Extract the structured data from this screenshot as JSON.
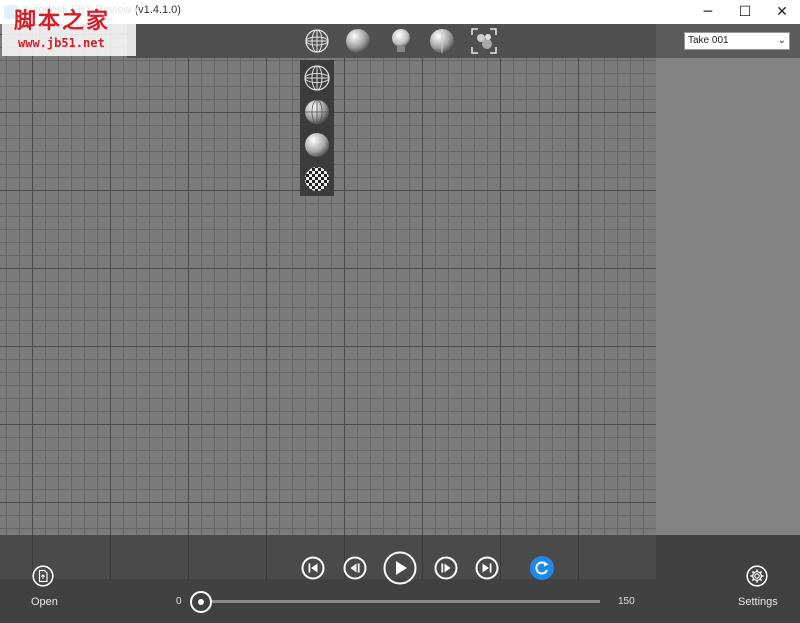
{
  "window": {
    "title": "Autodesk FBX Review (v1.4.1.0)",
    "min_glyph": "─",
    "max_glyph": "☐",
    "close_glyph": "✕"
  },
  "watermark": {
    "text": "脚本之家",
    "url": "www.jb51.net"
  },
  "take": {
    "selected": "Take 001",
    "chevron": "⌄"
  },
  "toolbar": {
    "icons": [
      "wireframe-sphere-icon",
      "shaded-sphere-icon",
      "light-bulb-icon",
      "half-sphere-icon",
      "frame-all-icon"
    ]
  },
  "shading_menu": {
    "icons": [
      "wireframe-icon",
      "wireframe-on-shaded-icon",
      "shaded-icon",
      "textured-icon"
    ]
  },
  "playback": {
    "buttons": [
      "go-to-start-icon",
      "step-back-icon",
      "play-icon",
      "step-forward-icon",
      "go-to-end-icon",
      "loop-icon"
    ]
  },
  "timeline": {
    "start": "0",
    "end": "150",
    "current_fraction": 0
  },
  "bottom": {
    "open_label": "Open",
    "settings_label": "Settings"
  }
}
